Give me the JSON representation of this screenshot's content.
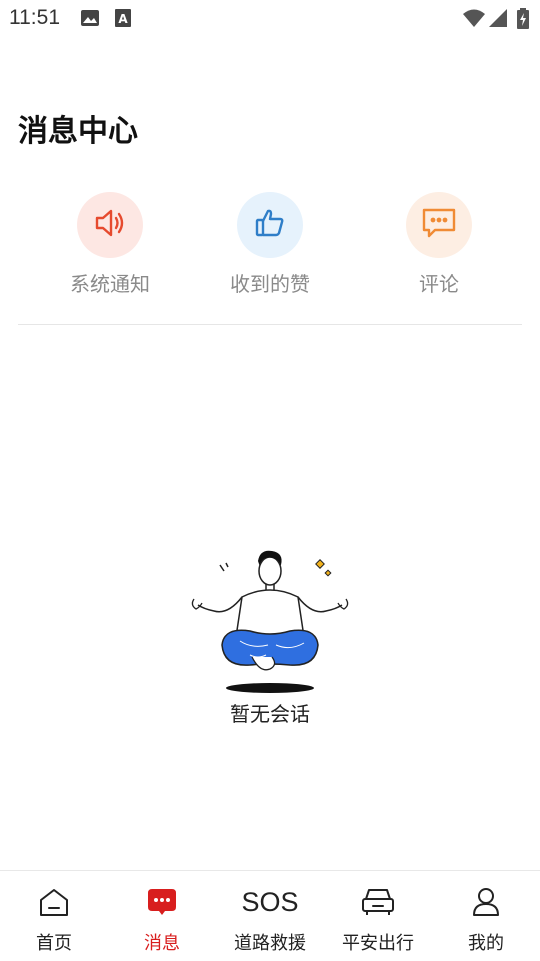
{
  "status_bar": {
    "time": "11:51",
    "icons": [
      "image-icon",
      "font-a-icon",
      "wifi-icon",
      "signal-icon",
      "battery-charging-icon"
    ]
  },
  "page": {
    "title": "消息中心"
  },
  "categories": [
    {
      "label": "系统通知",
      "icon": "speaker-icon",
      "bg_color": "#fde7e3",
      "icon_color": "#e64a2e"
    },
    {
      "label": "收到的赞",
      "icon": "thumbs-up-icon",
      "bg_color": "#e6f2fc",
      "icon_color": "#2f7ec8"
    },
    {
      "label": "评论",
      "icon": "comment-icon",
      "bg_color": "#fdeee3",
      "icon_color": "#f08b35"
    }
  ],
  "empty_state": {
    "text": "暂无会话",
    "illustration": "meditating-person-illustration"
  },
  "tabbar": {
    "active_color": "#d81e1e",
    "tabs": [
      {
        "label": "首页",
        "icon": "home-icon",
        "active": false
      },
      {
        "label": "消息",
        "icon": "message-icon",
        "active": true
      },
      {
        "label": "道路救援",
        "icon_text": "SOS",
        "icon": "sos-icon",
        "active": false
      },
      {
        "label": "平安出行",
        "icon": "car-icon",
        "active": false
      },
      {
        "label": "我的",
        "icon": "user-icon",
        "active": false
      }
    ]
  }
}
